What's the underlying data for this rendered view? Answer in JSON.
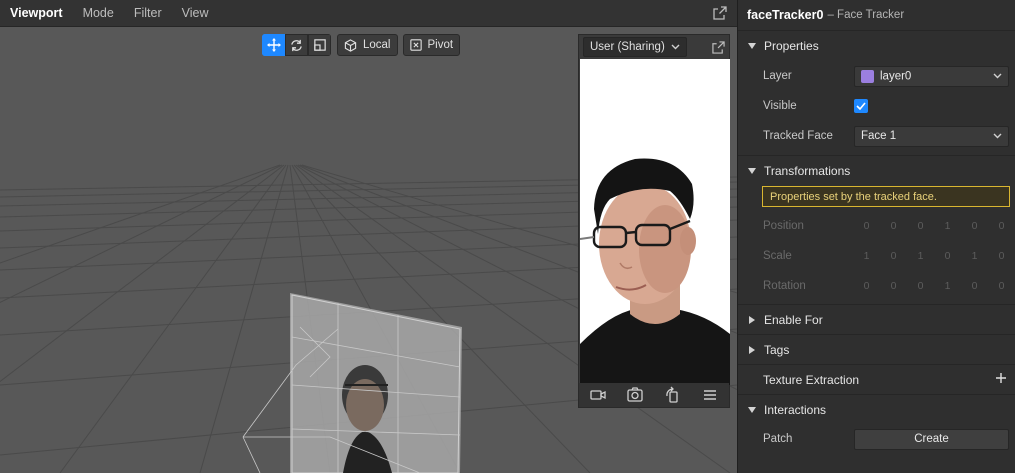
{
  "viewport": {
    "menus": [
      "Viewport",
      "Mode",
      "Filter",
      "View"
    ],
    "toolbar": {
      "local_label": "Local",
      "pivot_label": "Pivot"
    }
  },
  "simulator": {
    "device_label": "User (Sharing)"
  },
  "inspector": {
    "object_name": "faceTracker0",
    "object_type": "– Face Tracker",
    "sections": {
      "properties": "Properties",
      "transformations": "Transformations",
      "enable_for": "Enable For",
      "tags": "Tags",
      "texture_extraction": "Texture Extraction",
      "interactions": "Interactions"
    },
    "layer_label": "Layer",
    "layer_value": "layer0",
    "visible_label": "Visible",
    "tracked_face_label": "Tracked Face",
    "tracked_face_value": "Face 1",
    "notice": "Properties set by the tracked face.",
    "position_label": "Position",
    "position_values": [
      "0",
      "0",
      "0",
      "1",
      "0",
      "0"
    ],
    "scale_label": "Scale",
    "scale_values": [
      "1",
      "0",
      "1",
      "0",
      "1",
      "0"
    ],
    "rotation_label": "Rotation",
    "rotation_values": [
      "0",
      "0",
      "0",
      "1",
      "0",
      "0"
    ],
    "patch_label": "Patch",
    "create_label": "Create"
  },
  "colors": {
    "accent": "#1e88ff",
    "layer_swatch": "#9b7fe0",
    "notice_border": "#d9b630"
  }
}
